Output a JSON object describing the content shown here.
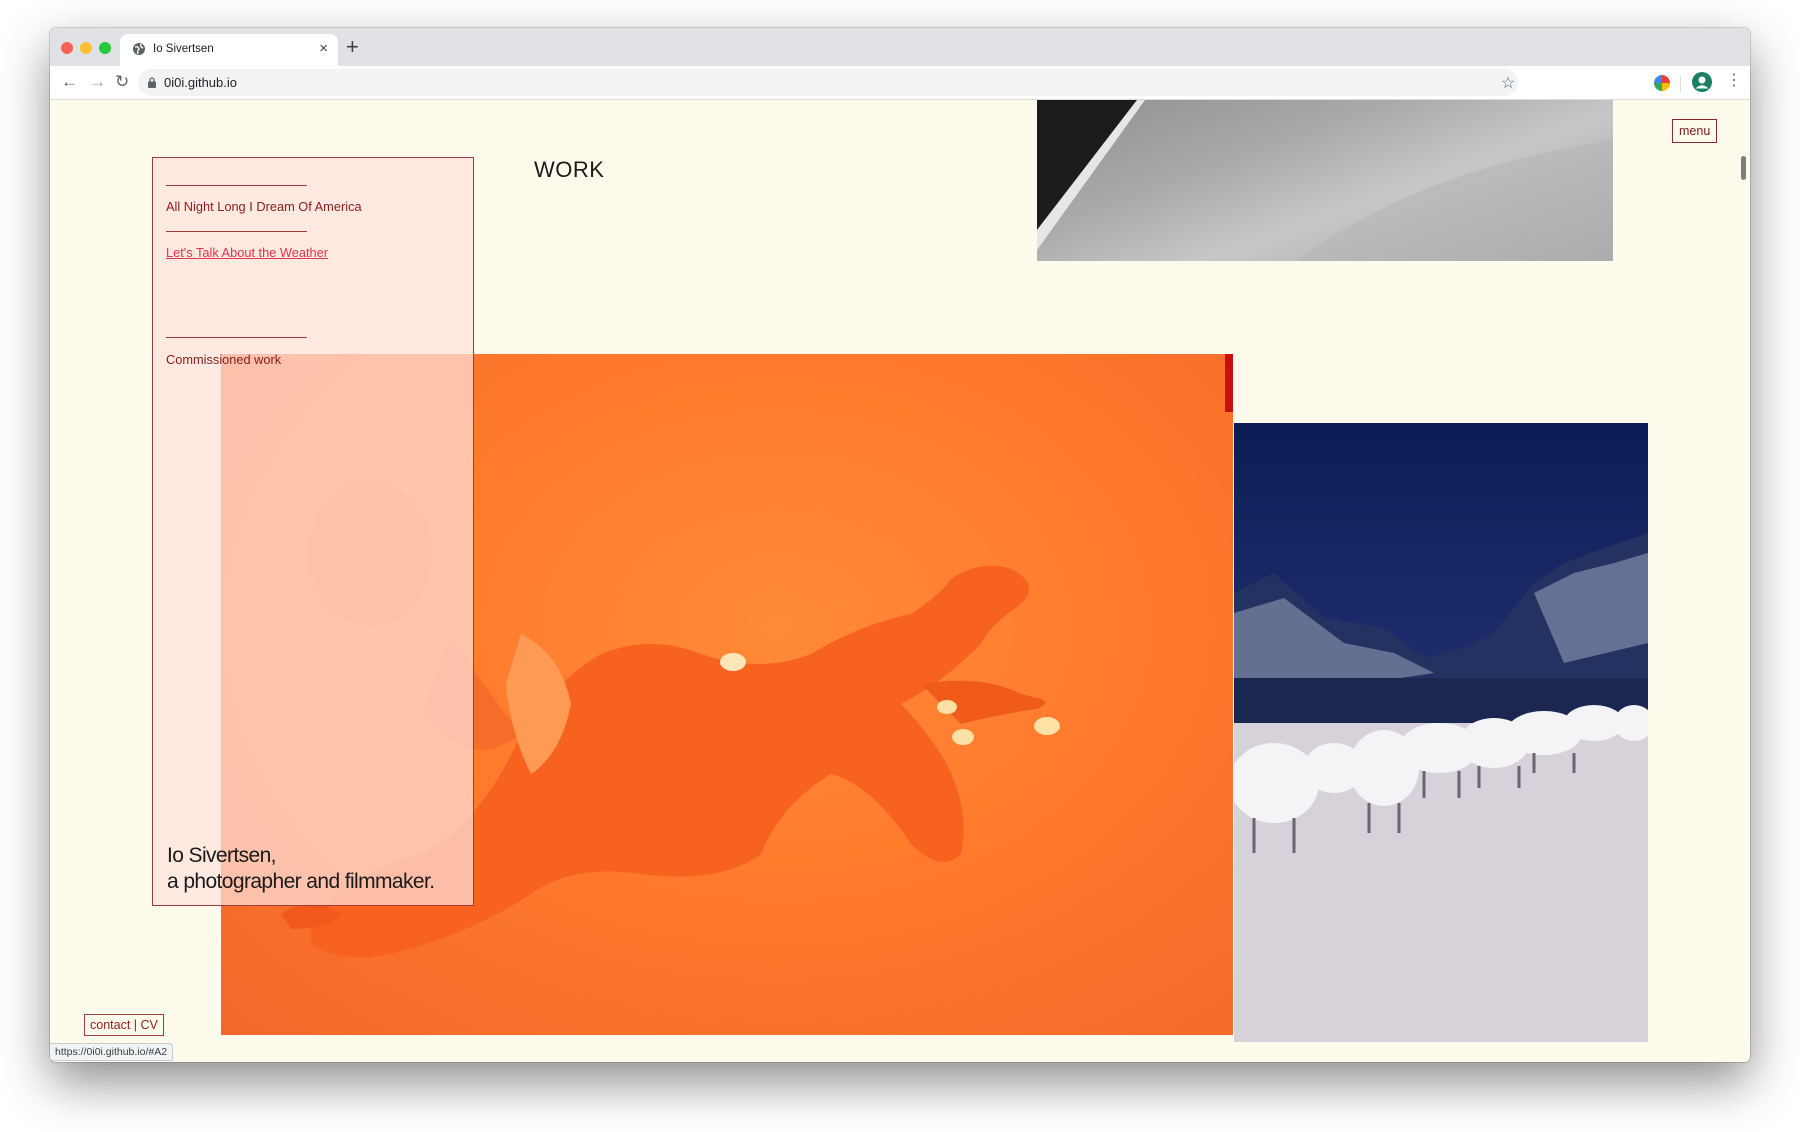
{
  "browser": {
    "tab_title": "Io Sivertsen",
    "new_tab_glyph": "+",
    "close_glyph": "×",
    "url": "0i0i.github.io",
    "status_url": "https://0i0i.github.io/#A2",
    "icons": [
      "globe-icon",
      "back-icon",
      "forward-icon",
      "reload-icon",
      "lock-icon",
      "star-icon",
      "extension-icon",
      "profile-icon",
      "kebab-menu-icon"
    ]
  },
  "page": {
    "heading": "WORK",
    "menu_label": "menu",
    "contact_label": "contact | CV",
    "sidebar": {
      "items": [
        {
          "label": "All Night Long I Dream Of America",
          "active": false
        },
        {
          "label": "Let's Talk About the Weather",
          "active": true
        },
        {
          "label": "Commissioned work",
          "active": false
        }
      ]
    },
    "bio": {
      "line1": "Io Sivertsen,",
      "line2": "a photographer and filmmaker."
    },
    "colors": {
      "background": "#fffbec",
      "accent": "#8a1d1d",
      "link_active": "#e0344e",
      "sidebar_fill": "#ffe2dc"
    }
  }
}
